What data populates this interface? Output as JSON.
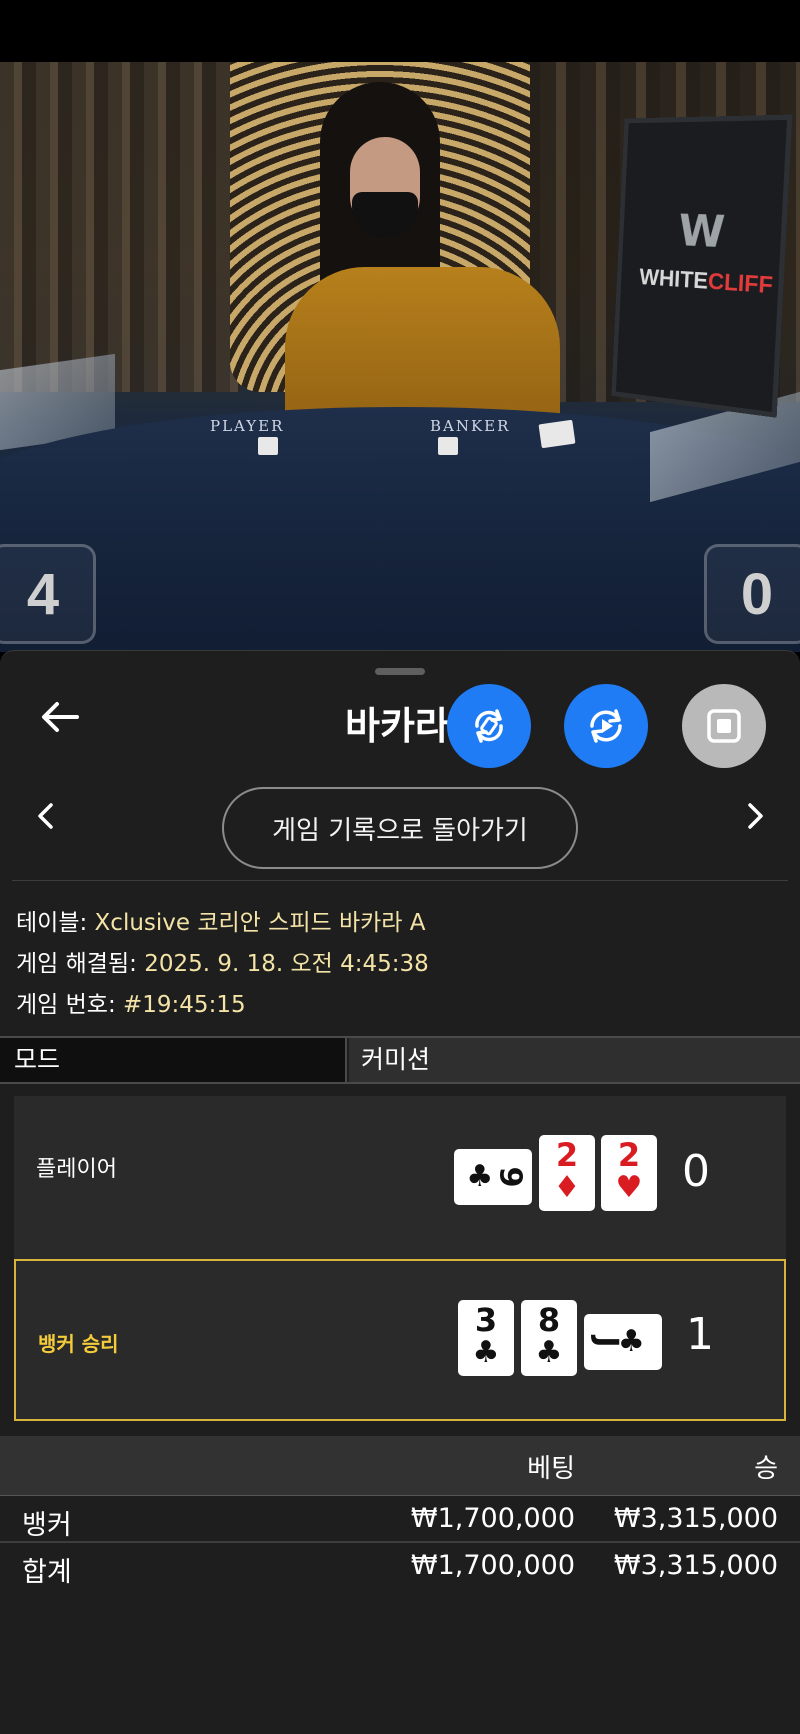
{
  "video": {
    "table_labels": {
      "player": "PLAYER",
      "banker": "BANKER"
    },
    "brand": {
      "white_part": "WHITE",
      "red_part": "CLIFF",
      "logo_letter": "W"
    },
    "scores": {
      "left": "4",
      "right": "0"
    }
  },
  "header": {
    "title": "바카라",
    "back_icon": "arrow-left-icon",
    "buttons": [
      {
        "name": "rotate-screen",
        "icon": "rotate-icon",
        "color": "#1f7cf5"
      },
      {
        "name": "replay",
        "icon": "replay-icon",
        "color": "#1f7cf5"
      },
      {
        "name": "minimize",
        "icon": "square-stop-icon",
        "color": "#b9b9b9"
      }
    ]
  },
  "navigation": {
    "history_button": "게임 기록으로 돌아가기"
  },
  "info": {
    "table_label": "테이블:",
    "table_value": "Xclusive 코리안 스피드 바카라 A",
    "resolved_label": "게임 해결됨:",
    "resolved_value": "2025. 9. 18. 오전 4:45:38",
    "number_label": "게임 번호:",
    "number_value": "#19:45:15"
  },
  "mode": {
    "label": "모드",
    "value": "커미션"
  },
  "result": {
    "player": {
      "label": "플레이어",
      "score": "0",
      "cards": [
        {
          "rank": "9",
          "suit": "♣",
          "color": "black",
          "orientation": "sideways"
        },
        {
          "rank": "2",
          "suit": "♦",
          "color": "red",
          "orientation": "upright"
        },
        {
          "rank": "2",
          "suit": "♥",
          "color": "red",
          "orientation": "upright"
        }
      ]
    },
    "banker": {
      "label": "뱅커 승리",
      "score": "1",
      "cards": [
        {
          "rank": "3",
          "suit": "♣",
          "color": "black",
          "orientation": "upright"
        },
        {
          "rank": "8",
          "suit": "♣",
          "color": "black",
          "orientation": "upright"
        },
        {
          "rank": "J",
          "suit": "♣",
          "color": "black",
          "orientation": "sideways"
        }
      ]
    }
  },
  "bets": {
    "header": {
      "bet": "베팅",
      "win": "승"
    },
    "rows": [
      {
        "name": "뱅커",
        "bet": "₩1,700,000",
        "win": "₩3,315,000"
      },
      {
        "name": "합계",
        "bet": "₩1,700,000",
        "win": "₩3,315,000"
      }
    ]
  }
}
